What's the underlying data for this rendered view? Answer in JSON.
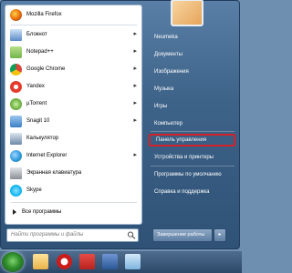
{
  "start_menu": {
    "pinned_programs": [
      {
        "label": "Mozilla Firefox",
        "icon": "firefox-icon",
        "color": "#e66000",
        "has_submenu": false
      }
    ],
    "recent_programs": [
      {
        "label": "Блокнот",
        "icon": "notepad-icon",
        "color": "#5b8ac9",
        "has_submenu": true
      },
      {
        "label": "Notepad++",
        "icon": "notepadpp-icon",
        "color": "#73b34a",
        "has_submenu": true
      },
      {
        "label": "Google Chrome",
        "icon": "chrome-icon",
        "color": "#db4437",
        "has_submenu": true
      },
      {
        "label": "Yandex",
        "icon": "yandex-icon",
        "color": "#e53b2c",
        "has_submenu": true
      },
      {
        "label": "µTorrent",
        "icon": "utorrent-icon",
        "color": "#5fa832",
        "has_submenu": true
      },
      {
        "label": "Snagit 10",
        "icon": "snagit-icon",
        "color": "#3a7fc5",
        "has_submenu": true
      },
      {
        "label": "Калькулятор",
        "icon": "calculator-icon",
        "color": "#6d8aa8",
        "has_submenu": false
      },
      {
        "label": "Internet Explorer",
        "icon": "ie-icon",
        "color": "#1e8fd6",
        "has_submenu": true
      },
      {
        "label": "Экранная клавиатура",
        "icon": "keyboard-icon",
        "color": "#8a8f96",
        "has_submenu": false
      },
      {
        "label": "Skype",
        "icon": "skype-icon",
        "color": "#00aff0",
        "has_submenu": false
      }
    ],
    "all_programs_label": "Все программы",
    "search_placeholder": "Найти программы и файлы",
    "right_items": [
      {
        "label": "Neumeka",
        "has_submenu": false,
        "highlighted": false
      },
      {
        "label": "Документы",
        "has_submenu": false,
        "highlighted": false
      },
      {
        "label": "Изображения",
        "has_submenu": false,
        "highlighted": false
      },
      {
        "label": "Музыка",
        "has_submenu": false,
        "highlighted": false
      },
      {
        "label": "Игры",
        "has_submenu": false,
        "highlighted": false
      },
      {
        "label": "Компьютер",
        "has_submenu": false,
        "highlighted": false
      },
      {
        "label": "Панель управления",
        "has_submenu": false,
        "highlighted": true
      },
      {
        "label": "Устройства и принтеры",
        "has_submenu": false,
        "highlighted": false
      },
      {
        "label": "Программы по умолчанию",
        "has_submenu": false,
        "highlighted": false
      },
      {
        "label": "Справка и поддержка",
        "has_submenu": false,
        "highlighted": false
      }
    ],
    "shutdown_label": "Завершение работы",
    "highlight_color": "#d2232a"
  },
  "taskbar": {
    "icons": [
      {
        "name": "explorer-icon",
        "color": "#e8b34a"
      },
      {
        "name": "opera-icon",
        "color": "#cc1b1b"
      },
      {
        "name": "filezilla-icon",
        "color": "#b8221f"
      },
      {
        "name": "word-icon",
        "color": "#2b5797"
      },
      {
        "name": "window-icon",
        "color": "#7fb4de"
      }
    ]
  }
}
